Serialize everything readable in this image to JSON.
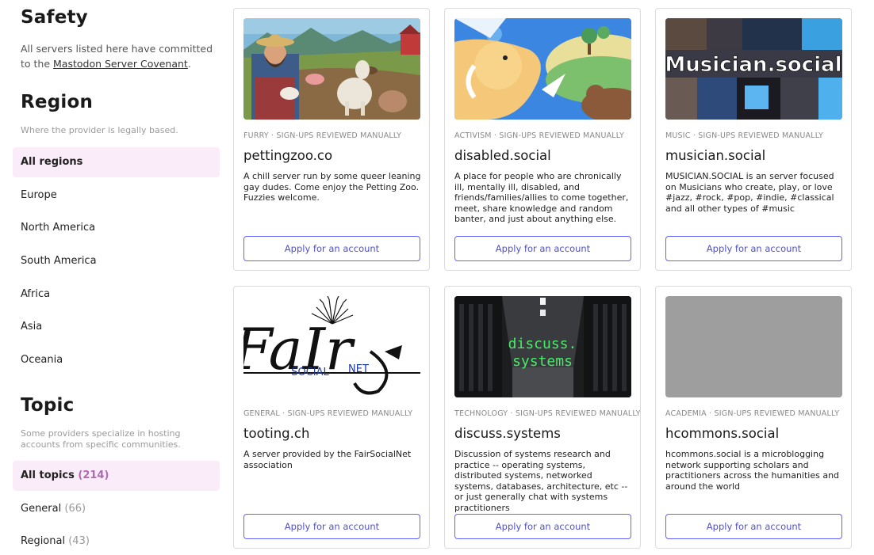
{
  "sidebar": {
    "safety": {
      "title": "Safety",
      "text_prefix": "All servers listed here have committed to the ",
      "link": "Mastodon Server Covenant",
      "text_suffix": "."
    },
    "region": {
      "title": "Region",
      "subtitle": "Where the provider is legally based.",
      "items": [
        {
          "label": "All regions",
          "active": true
        },
        {
          "label": "Europe"
        },
        {
          "label": "North America"
        },
        {
          "label": "South America"
        },
        {
          "label": "Africa"
        },
        {
          "label": "Asia"
        },
        {
          "label": "Oceania"
        }
      ]
    },
    "topic": {
      "title": "Topic",
      "subtitle": "Some providers specialize in hosting accounts from specific communities.",
      "items": [
        {
          "label": "All topics",
          "count": "(214)",
          "active": true
        },
        {
          "label": "General",
          "count": "(66)"
        },
        {
          "label": "Regional",
          "count": "(43)"
        }
      ]
    }
  },
  "cards": [
    {
      "meta": "FURRY · SIGN-UPS REVIEWED MANUALLY",
      "name": "pettingzoo.co",
      "description": "A chill server run by some queer leaning gay dudes. Come enjoy the Petting Zoo. Fuzzies welcome.",
      "button": "Apply for an account",
      "image": "farm-illustration"
    },
    {
      "meta": "ACTIVISM · SIGN-UPS REVIEWED MANUALLY",
      "name": "disabled.social",
      "description": "A place for people who are chronically ill, mentally ill, disabled, and friends/families/allies to come together, meet, share knowledge and random banter, and just about anything else.",
      "button": "Apply for an account",
      "image": "elephant-illustration"
    },
    {
      "meta": "MUSIC · SIGN-UPS REVIEWED MANUALLY",
      "name": "musician.social",
      "description": "MUSICIAN.SOCIAL is an server focused on Musicians who create, play, or love #jazz, #rock, #pop, #indie, #classical and all other types of #music",
      "button": "Apply for an account",
      "image": "musician-collage",
      "image_text": "Musician.social"
    },
    {
      "meta": "GENERAL · SIGN-UPS REVIEWED MANUALLY",
      "name": "tooting.ch",
      "description": "A server provided by the FairSocialNet association",
      "button": "Apply for an account",
      "image": "fairsocialnet-logo",
      "image_text": "FaIr",
      "image_text_social": "SOCIAL",
      "image_text_net": "NET"
    },
    {
      "meta": "TECHNOLOGY · SIGN-UPS REVIEWED MANUALLY",
      "name": "discuss.systems",
      "description": "Discussion of systems research and practice -- operating systems, distributed systems, networked systems, databases, architecture, etc -- or just generally chat with systems practitioners",
      "button": "Apply for an account",
      "image": "server-room",
      "image_text_line1": "discuss.",
      "image_text_line2": "systems"
    },
    {
      "meta": "ACADEMIA · SIGN-UPS REVIEWED MANUALLY",
      "name": "hcommons.social",
      "description": "hcommons.social is a microblogging network supporting scholars and practitioners across the humanities and around the world",
      "button": "Apply for an account",
      "image": "gray-placeholder"
    }
  ]
}
